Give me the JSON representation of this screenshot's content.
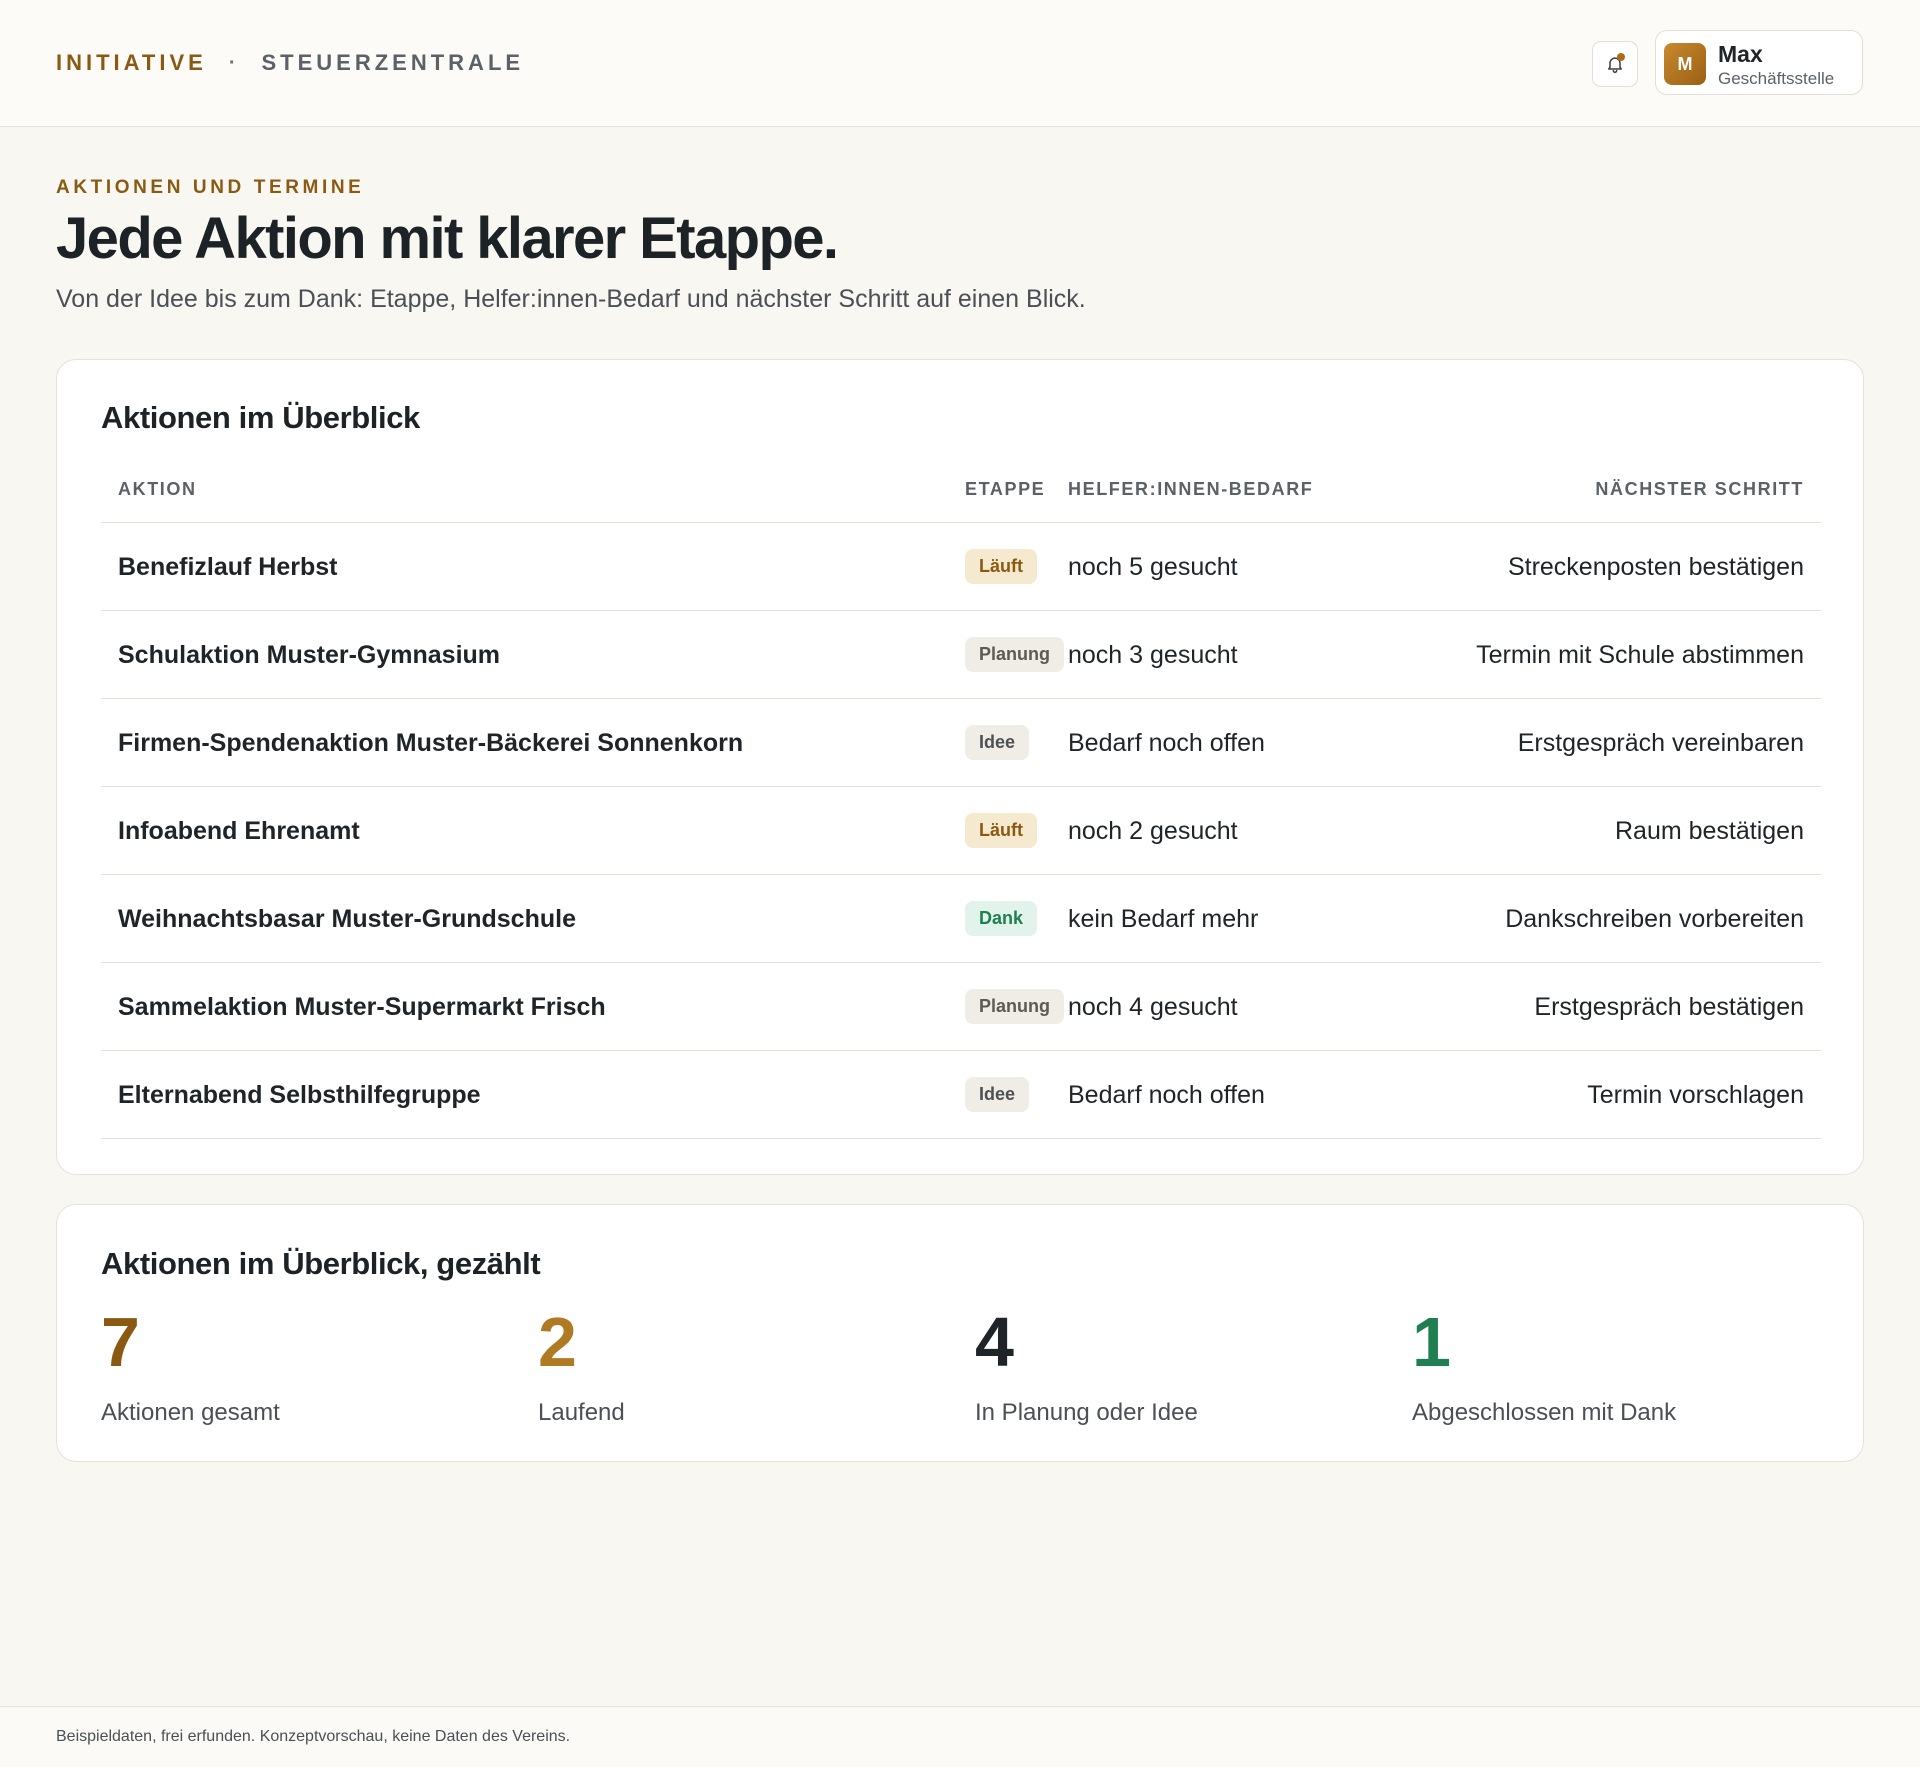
{
  "header": {
    "brand_primary": "INITIATIVE",
    "brand_separator": "·",
    "brand_secondary": "STEUERZENTRALE",
    "user": {
      "initial": "M",
      "name": "Max",
      "role": "Geschäftsstelle"
    }
  },
  "hero": {
    "eyebrow": "AKTIONEN UND TERMINE",
    "title": "Jede Aktion mit klarer Etappe.",
    "subtitle": "Von der Idee bis zum Dank: Etappe, Helfer:innen-Bedarf und nächster Schritt auf einen Blick."
  },
  "table": {
    "title": "Aktionen im Überblick",
    "columns": [
      "AKTION",
      "ETAPPE",
      "HELFER:INNEN-BEDARF",
      "NÄCHSTER SCHRITT"
    ],
    "rows": [
      {
        "name": "Benefizlauf Herbst",
        "stage": "Läuft",
        "stage_key": "laeuft",
        "need": "noch 5 gesucht",
        "next": "Streckenposten bestätigen"
      },
      {
        "name": "Schulaktion Muster-Gymnasium",
        "stage": "Planung",
        "stage_key": "planung",
        "need": "noch 3 gesucht",
        "next": "Termin mit Schule abstimmen"
      },
      {
        "name": "Firmen-Spendenaktion Muster-Bäckerei Sonnenkorn",
        "stage": "Idee",
        "stage_key": "idee",
        "need": "Bedarf noch offen",
        "next": "Erstgespräch vereinbaren"
      },
      {
        "name": "Infoabend Ehrenamt",
        "stage": "Läuft",
        "stage_key": "laeuft",
        "need": "noch 2 gesucht",
        "next": "Raum bestätigen"
      },
      {
        "name": "Weihnachtsbasar Muster-Grundschule",
        "stage": "Dank",
        "stage_key": "dank",
        "need": "kein Bedarf mehr",
        "next": "Dankschreiben vorbereiten"
      },
      {
        "name": "Sammelaktion Muster-Supermarkt Frisch",
        "stage": "Planung",
        "stage_key": "planung",
        "need": "noch 4 gesucht",
        "next": "Erstgespräch bestätigen"
      },
      {
        "name": "Elternabend Selbsthilfegruppe",
        "stage": "Idee",
        "stage_key": "idee",
        "need": "Bedarf noch offen",
        "next": "Termin vorschlagen"
      }
    ]
  },
  "stats": {
    "title": "Aktionen im Überblick, gezählt",
    "items": [
      {
        "value": "7",
        "label": "Aktionen gesamt",
        "color": "#8a5a12"
      },
      {
        "value": "2",
        "label": "Laufend",
        "color": "#b07a22"
      },
      {
        "value": "4",
        "label": "In Planung oder Idee",
        "color": "#1f2428"
      },
      {
        "value": "1",
        "label": "Abgeschlossen mit Dank",
        "color": "#1f7f52"
      }
    ]
  },
  "footer": {
    "note": "Beispieldaten, frei erfunden. Konzeptvorschau, keine Daten des Vereins."
  },
  "icons": {
    "bell": "bell-icon",
    "avatar": "avatar"
  },
  "colors": {
    "accent": "#8a5a12",
    "background": "#f9f7f2",
    "success": "#1f7f52"
  }
}
